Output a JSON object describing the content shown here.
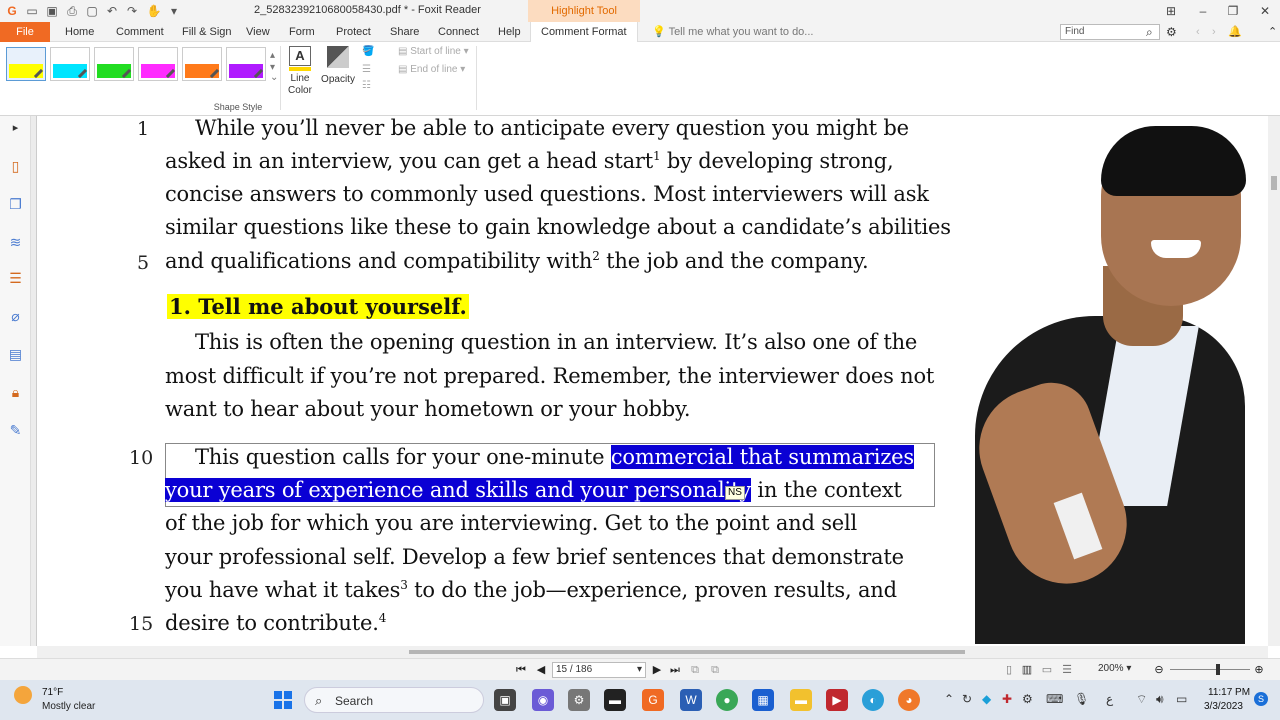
{
  "window": {
    "title": "2_5283239210680058430.pdf * - Foxit Reader",
    "context_tab_header": "Highlight Tool"
  },
  "ribbon_tabs": [
    "File",
    "Home",
    "Comment",
    "Fill & Sign",
    "View",
    "Form",
    "Protect",
    "Share",
    "Connect",
    "Help",
    "Comment Format"
  ],
  "tell_me": "Tell me what you want to do...",
  "find": {
    "placeholder": "Find"
  },
  "ribbon": {
    "swatch_colors": [
      "#ffff00",
      "#00e5ff",
      "#22dd22",
      "#ff2bff",
      "#ff7a1a",
      "#b01bff"
    ],
    "shape_style_label": "Shape Style",
    "line_color_label": "Line Color",
    "opacity_label": "Opacity",
    "start_of_line": "Start of line",
    "end_of_line": "End of line"
  },
  "sidebar_icons": [
    "pages-icon",
    "layers-icon",
    "stack-icon",
    "comments-icon",
    "attachment-icon",
    "fields-icon",
    "lock-icon",
    "stamp-icon"
  ],
  "document": {
    "line_numbers": [
      "1",
      "5",
      "10",
      "15"
    ],
    "paragraph1": [
      "While you’ll never be able to anticipate every question you might be",
      "asked in an interview, you can get a head start",
      "concise answers to commonly used questions. Most interviewers will ask",
      "similar questions like these to gain knowledge about a candidate’s abilities",
      "and qualifications and compatibility with"
    ],
    "p1_sup1": "1",
    "p1_line2_end": " by developing strong,",
    "p1_sup2": "2",
    "p1_line5_end": " the job and the company.",
    "heading": "1. Tell me about yourself.",
    "paragraph2": [
      "This is often the opening question in an interview. It’s also one of the",
      "most difficult if you’re not prepared. Remember, the interviewer does not",
      "want to hear about your hometown or your hobby."
    ],
    "p3_line1_plain": "This question calls for your one-minute ",
    "p3_line1_highlight": "commercial that summarizes",
    "p3_line2_highlight": "your years of experience and skills and your personality",
    "p3_line2_plain": " in the context",
    "paragraph3_rest": [
      "of the job for which you are interviewing. Get to the point and sell",
      "your professional self. Develop a few brief sentences that demonstrate",
      "you have what it takes",
      "desire to contribute."
    ],
    "p3_sup3": "3",
    "p3_line5_end": " to do the job—experience, proven results, and",
    "p3_sup4": "4",
    "tooltip": "NS"
  },
  "statusbar": {
    "page_indicator": "15 / 186",
    "zoom": "200%"
  },
  "taskbar": {
    "weather_temp": "71°F",
    "weather_cond": "Mostly clear",
    "search_label": "Search",
    "time": "11:17 PM",
    "date": "3/3/2023"
  }
}
